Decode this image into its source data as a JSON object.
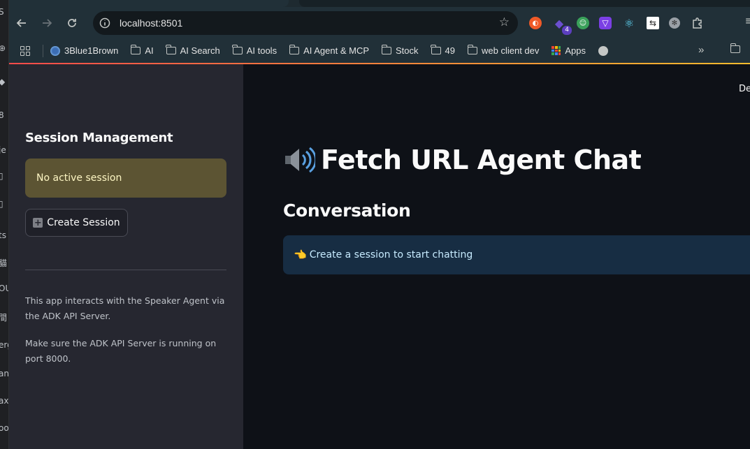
{
  "browser": {
    "url": "localhost:8501",
    "extension_badge": "4",
    "bookmarks": [
      {
        "label": "3Blue1Brown",
        "icon": "3blue1brown-icon"
      },
      {
        "label": "AI",
        "icon": "folder-icon"
      },
      {
        "label": "AI Search",
        "icon": "folder-icon"
      },
      {
        "label": "AI tools",
        "icon": "folder-icon"
      },
      {
        "label": "AI Agent & MCP",
        "icon": "folder-icon"
      },
      {
        "label": "Stock",
        "icon": "folder-icon"
      },
      {
        "label": "49",
        "icon": "folder-icon"
      },
      {
        "label": "web client dev",
        "icon": "folder-icon"
      },
      {
        "label": "Apps",
        "icon": "apps-grid-icon"
      }
    ]
  },
  "sidebar": {
    "title": "Session Management",
    "status": "No active session",
    "create_button": "Create Session",
    "info_1": "This app interacts with the Speaker Agent via the ADK API Server.",
    "info_2": "Make sure the ADK API Server is running on port 8000."
  },
  "main": {
    "deploy_label": "De",
    "title": "Fetch URL Agent Chat",
    "subheading": "Conversation",
    "info_message": "Create a session to start chatting"
  },
  "colors": {
    "sidebar_bg": "#262730",
    "main_bg": "#0e1117",
    "warning_bg": "#5c5433",
    "info_bg": "#172d43",
    "accent_gradient_start": "#ff4b4b",
    "accent_gradient_end": "#fdbb2d"
  }
}
